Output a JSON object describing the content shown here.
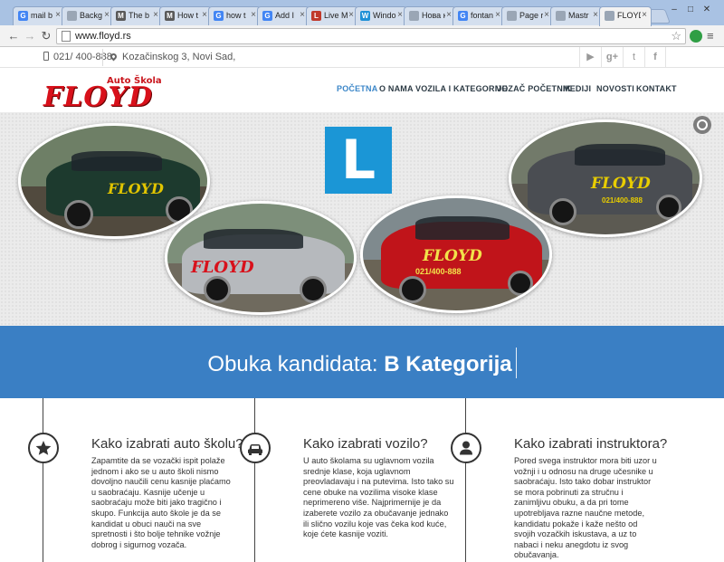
{
  "browser": {
    "tabs": [
      {
        "label": "mail b",
        "icon": "google-icon"
      },
      {
        "label": "Backg",
        "icon": "page-icon"
      },
      {
        "label": "The b",
        "icon": "mail-icon"
      },
      {
        "label": "How t",
        "icon": "mail-icon"
      },
      {
        "label": "how t",
        "icon": "google-icon"
      },
      {
        "label": "Add I",
        "icon": "google-icon"
      },
      {
        "label": "Live M",
        "icon": "live-icon"
      },
      {
        "label": "Windo",
        "icon": "windows-icon"
      },
      {
        "label": "Нова кар",
        "icon": "page-icon"
      },
      {
        "label": "fontan",
        "icon": "google-icon"
      },
      {
        "label": "Page r",
        "icon": "page-icon"
      },
      {
        "label": "Mastr",
        "icon": "page-icon"
      },
      {
        "label": "FLOYD",
        "icon": "page-icon"
      }
    ],
    "url": "www.floyd.rs"
  },
  "site": {
    "topbar": {
      "phone": "021/ 400-888",
      "address": "Kozačinskog 3, Novi Sad,",
      "social": [
        "youtube-icon",
        "google-plus-icon",
        "twitter-icon",
        "facebook-icon"
      ]
    },
    "logo": {
      "subtitle": "Auto Škola",
      "name": "FLOYD"
    },
    "nav": [
      "POČETNA",
      "O NAMA",
      "VOZILA I KATEGORIJE",
      "VOZAČ POČETNIK",
      "MEDIJI",
      "NOVOSTI",
      "KONTAKT"
    ],
    "hero": {
      "sign_letter": "L",
      "car_labels": [
        "FLOYD",
        "FLOYD",
        "FLOYD",
        "FLOYD"
      ],
      "car_phone": "021/400-888"
    },
    "banner": {
      "prefix": "Obuka kandidata: ",
      "highlight": "B Kategorija"
    },
    "features": [
      {
        "icon": "star-icon",
        "title": "Kako izabrati auto školu?",
        "text": "Zapamtite da se vozački ispit polaže jednom i ako se u auto školi nismo dovoljno naučili cenu kasnije plaćamo u saobraćaju. Kasnije učenje u saobraćaju može biti jako tragično i skupo. Funkcija auto škole je da se kandidat u obuci nauči na sve spretnosti i što bolje tehnike vožnje dobrog i sigurnog vozača."
      },
      {
        "icon": "car-icon",
        "title": "Kako izabrati vozilo?",
        "text": "U auto školama su uglavnom vozila srednje klase, koja uglavnom preovladavaju i na putevima. Isto tako su cene obuke na vozilima visoke klase neprimereno više. Najprimernije je da izaberete vozilo za obučavanje jednako ili slično vozilu koje vas čeka kod kuće, koje ćete kasnije voziti."
      },
      {
        "icon": "user-icon",
        "title": "Kako izabrati instruktora?",
        "text": "Pored svega instruktor mora biti uzor u vožnji i u odnosu na druge učesnike u saobraćaju. Isto tako dobar instruktor se mora pobrinuti za stručnu i zanimljivu obuku, a da pri tome upotrebljava razne naučne metode, kandidatu pokaže i kaže nešto od svojih vozačkih iskustava, a uz to nabaci i neku anegdotu iz svog obučavanja."
      }
    ]
  }
}
